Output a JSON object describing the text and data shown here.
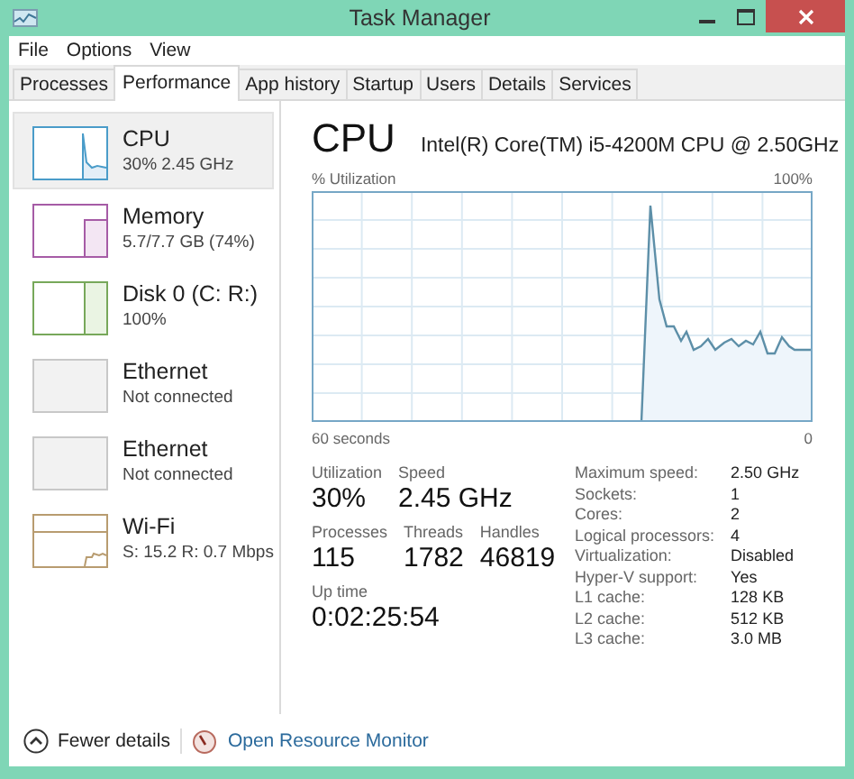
{
  "window": {
    "title": "Task Manager"
  },
  "menu": [
    "File",
    "Options",
    "View"
  ],
  "tabs": [
    {
      "label": "Processes",
      "selected": false
    },
    {
      "label": "Performance",
      "selected": true
    },
    {
      "label": "App history",
      "selected": false
    },
    {
      "label": "Startup",
      "selected": false
    },
    {
      "label": "Users",
      "selected": false
    },
    {
      "label": "Details",
      "selected": false
    },
    {
      "label": "Services",
      "selected": false
    }
  ],
  "sidebar": {
    "items": [
      {
        "kind": "cpu",
        "name": "CPU",
        "detail": "30% 2.45 GHz",
        "color": "#4a9cc9",
        "selected": true
      },
      {
        "kind": "memory",
        "name": "Memory",
        "detail": "5.7/7.7 GB (74%)",
        "color": "#a65ca6",
        "selected": false
      },
      {
        "kind": "disk",
        "name": "Disk 0 (C: R:)",
        "detail": "100%",
        "color": "#77a85a",
        "selected": false
      },
      {
        "kind": "idle",
        "name": "Ethernet",
        "detail": "Not connected",
        "color": "#c8c8c8",
        "selected": false
      },
      {
        "kind": "idle",
        "name": "Ethernet",
        "detail": "Not connected",
        "color": "#c8c8c8",
        "selected": false
      },
      {
        "kind": "wifi",
        "name": "Wi-Fi",
        "detail": "S: 15.2 R: 0.7 Mbps",
        "color": "#b89c70",
        "selected": false
      }
    ]
  },
  "main": {
    "title": "CPU",
    "processor": "Intel(R) Core(TM) i5-4200M CPU @ 2.50GHz",
    "graph": {
      "y_label": "% Utilization",
      "y_max": "100%",
      "x_label": "60 seconds",
      "x_end": "0"
    },
    "stats": [
      [
        {
          "label": "Utilization",
          "value": "30%"
        },
        {
          "label": "Speed",
          "value": "2.45 GHz"
        }
      ],
      [
        {
          "label": "Processes",
          "value": "115"
        },
        {
          "label": "Threads",
          "value": "1782"
        },
        {
          "label": "Handles",
          "value": "46819"
        }
      ],
      [
        {
          "label": "Up time",
          "value": "0:02:25:54"
        }
      ]
    ],
    "specs": [
      {
        "label": "Maximum speed:",
        "value": "2.50 GHz"
      },
      {
        "label": "Sockets:",
        "value": "1"
      },
      {
        "label": "Cores:",
        "value": "2"
      },
      {
        "label": "Logical processors:",
        "value": "4"
      },
      {
        "label": "Virtualization:",
        "value": "Disabled"
      },
      {
        "label": "Hyper-V support:",
        "value": "Yes"
      },
      {
        "label": "L1 cache:",
        "value": "128 KB"
      },
      {
        "label": "L2 cache:",
        "value": "512 KB"
      },
      {
        "label": "L3 cache:",
        "value": "3.0 MB"
      }
    ]
  },
  "footer": {
    "fewer_details": "Fewer details",
    "resource_monitor": "Open Resource Monitor"
  }
}
